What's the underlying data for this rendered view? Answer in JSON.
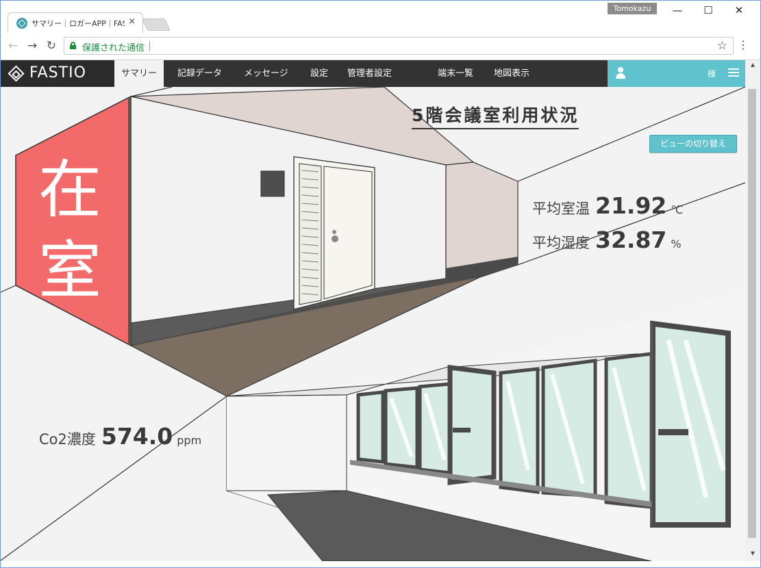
{
  "browser": {
    "tab_title": "サマリー｜ロガーAPP｜FASTIO",
    "tab_close": "×",
    "profile_name": "Tomokazu",
    "minimize": "—",
    "maximize": "☐",
    "close": "✕",
    "back": "←",
    "forward": "→",
    "reload": "↻",
    "secure_label": "保護された通信",
    "bookmark_star": "☆",
    "menu": "⋮"
  },
  "app": {
    "logo_text": "FASTIO",
    "nav": [
      {
        "label": "サマリー",
        "active": true
      },
      {
        "label": "記録データ"
      },
      {
        "label": "メッセージ"
      },
      {
        "label": "設定"
      },
      {
        "label": "管理者設定"
      },
      {
        "label": "端末一覧"
      },
      {
        "label": "地図表示"
      }
    ],
    "honorific": "様",
    "accent_color": "#5fc2cc",
    "header_color": "#333333"
  },
  "summary": {
    "title": "5階会議室利用状況",
    "view_toggle_label": "ビューの切り替え",
    "status": {
      "line1": "在",
      "line2": "室",
      "color": "#f26a6a"
    },
    "avg_temp": {
      "label": "平均室温",
      "value": "21.92",
      "unit": "℃"
    },
    "avg_humidity": {
      "label": "平均湿度",
      "value": "32.87",
      "unit": "%"
    },
    "co2": {
      "label": "Co2濃度",
      "value": "574.0",
      "unit": "ppm"
    }
  },
  "icons": {
    "favicon": "fastio-favicon-icon",
    "lock": "lock-icon",
    "user": "person-icon",
    "menu": "list-icon"
  }
}
